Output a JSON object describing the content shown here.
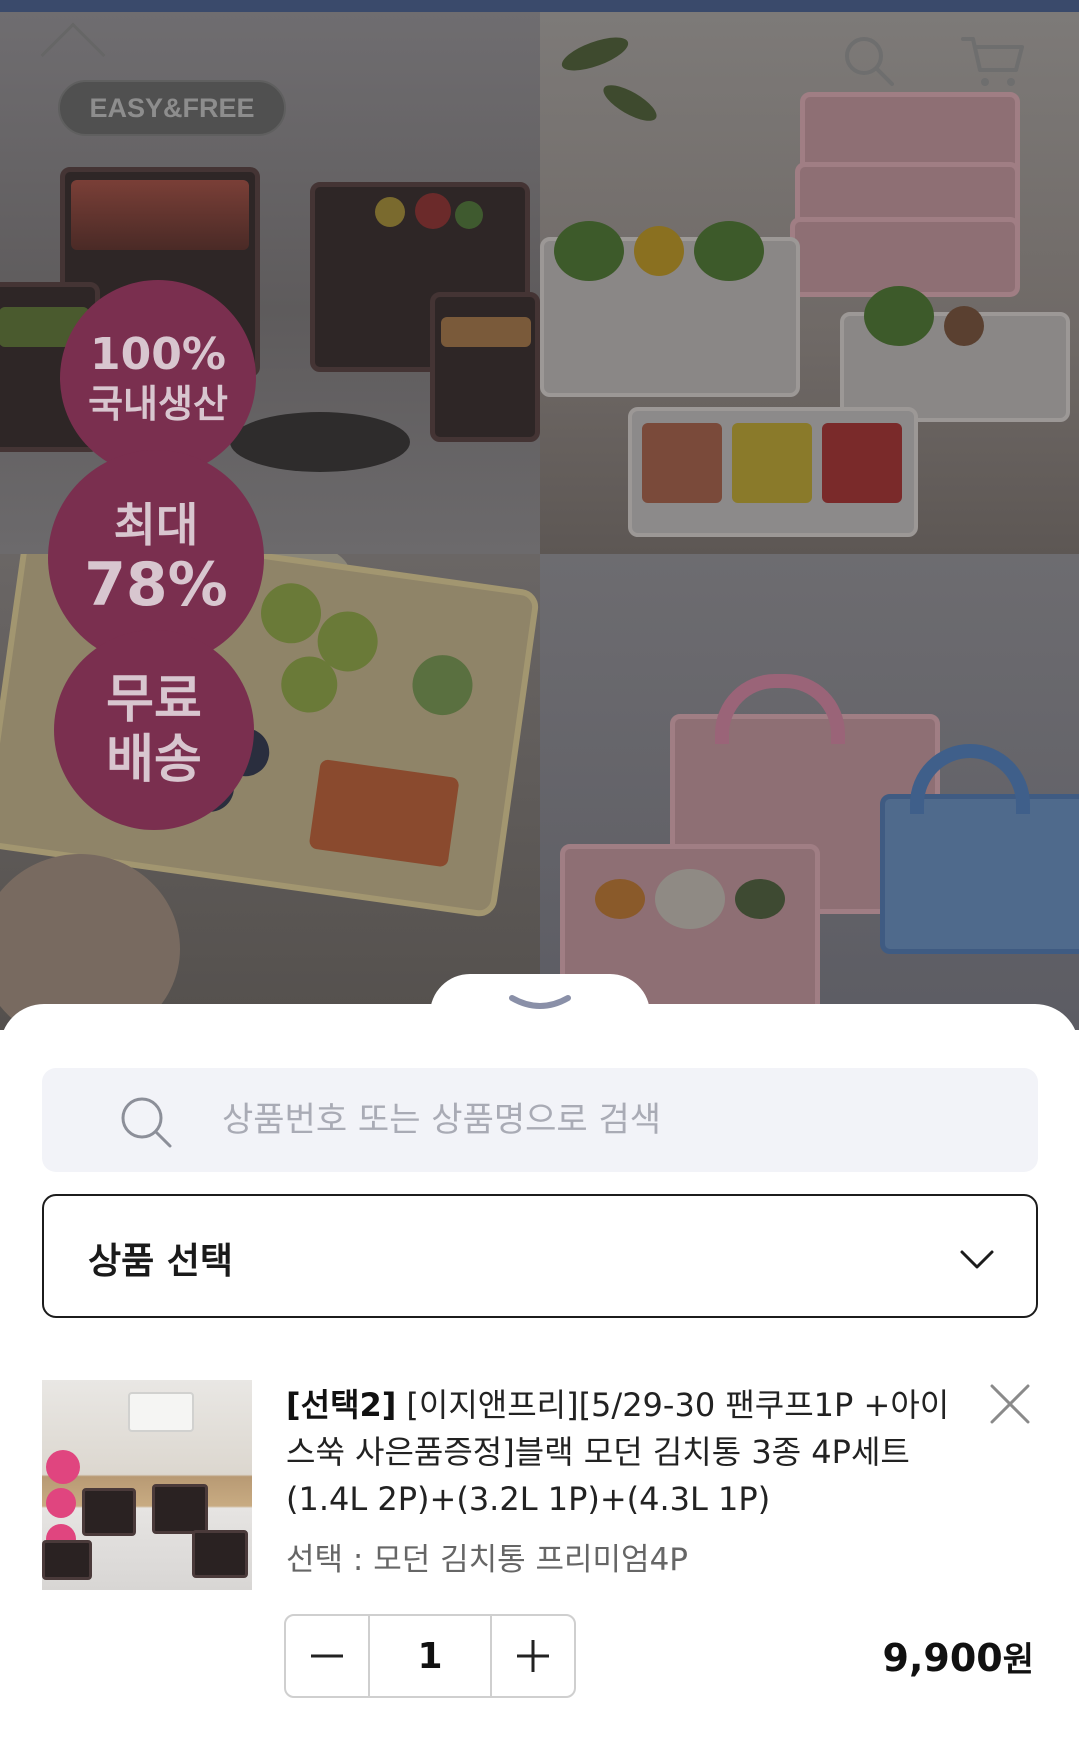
{
  "hero": {
    "logo": "EASY&FREE",
    "badges": [
      {
        "line1": "100%",
        "line2": "국내생산"
      },
      {
        "line1": "최대",
        "line2": "78%"
      },
      {
        "line1": "무료",
        "line2": "배송"
      }
    ],
    "icons": [
      "search-icon",
      "cart-icon"
    ]
  },
  "sheet": {
    "search": {
      "placeholder": "상품번호 또는 상품명으로 검색",
      "value": ""
    },
    "select": {
      "label": "상품 선택"
    },
    "item": {
      "tag": "[선택2]",
      "title": "[이지앤프리][5/29-30 팬쿠프1P +아이스쑥 사은품증정]블랙 모던 김치통 3종 4P세트 (1.4L 2P)+(3.2L 1P)+(4.3L 1P)",
      "option": "선택 : 모던 김치통 프리미엄4P",
      "quantity": "1",
      "price_number": "9,900",
      "price_unit": "원"
    }
  },
  "colors": {
    "badge": "#7a2f4f",
    "search_bg": "#f2f3f8",
    "placeholder": "#a9abb5",
    "border_dark": "#1c1c1c"
  }
}
